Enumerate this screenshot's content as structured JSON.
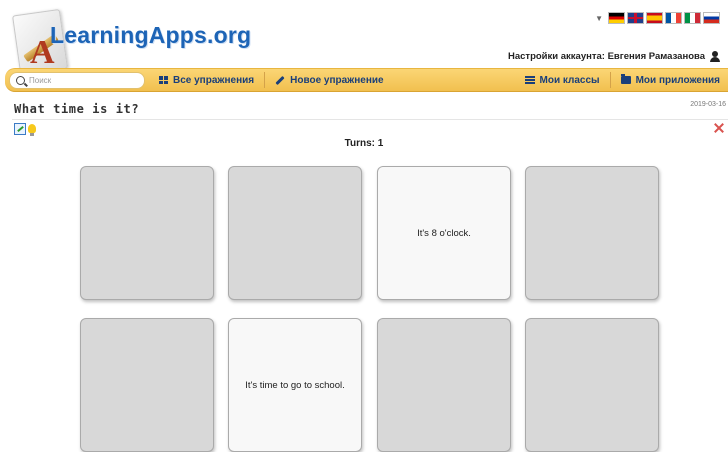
{
  "header": {
    "logo_text": "LearningApps.org",
    "account_label": "Настройки аккаунта: Евгения Рамазанова"
  },
  "languages": [
    "de",
    "en",
    "es",
    "fr",
    "it",
    "ru"
  ],
  "nav": {
    "search_placeholder": "Поиск",
    "all_exercises": "Все упражнения",
    "new_exercise": "Новое упражнение",
    "my_classes": "Мои классы",
    "my_apps": "Мои приложения"
  },
  "app": {
    "title": "What time is it?",
    "date": "2019-03-16",
    "turns_label": "Turns: 1"
  },
  "cards": [
    {
      "text": "",
      "state": "hidden"
    },
    {
      "text": "",
      "state": "hidden"
    },
    {
      "text": "It's 8 o'clock.",
      "state": "open"
    },
    {
      "text": "",
      "state": "hidden"
    },
    {
      "text": "",
      "state": "hidden"
    },
    {
      "text": "It's time to go to school.",
      "state": "open"
    },
    {
      "text": "",
      "state": "hidden"
    },
    {
      "text": "",
      "state": "hidden"
    }
  ],
  "colors": {
    "nav_bar": "#f1c04f",
    "logo_blue": "#1d64b6",
    "card_hidden": "#d8d8d8",
    "card_open": "#f8f8f8"
  }
}
